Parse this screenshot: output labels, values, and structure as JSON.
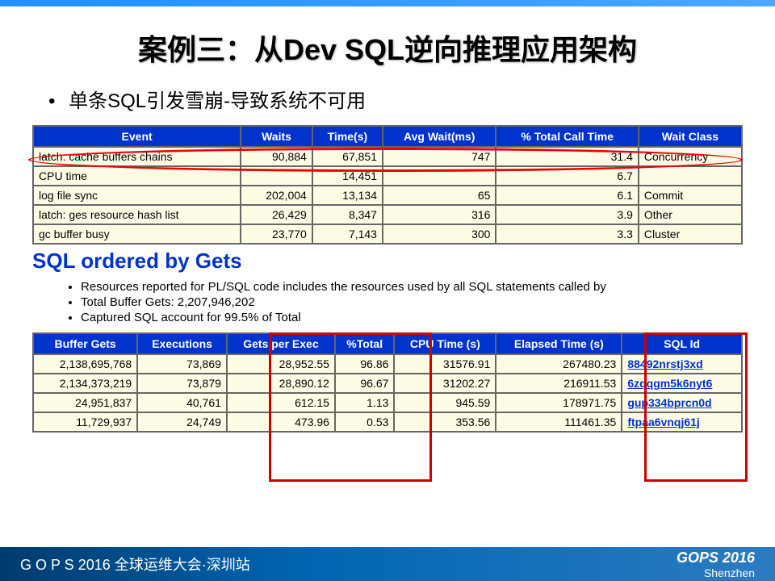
{
  "title": "案例三：从Dev SQL逆向推理应用架构",
  "bullet": "单条SQL引发雪崩-导致系统不可用",
  "table1": {
    "headers": [
      "Event",
      "Waits",
      "Time(s)",
      "Avg Wait(ms)",
      "% Total Call Time",
      "Wait Class"
    ],
    "rows": [
      [
        "latch: cache buffers chains",
        "90,884",
        "67,851",
        "747",
        "31.4",
        "Concurrency"
      ],
      [
        "CPU time",
        "",
        "14,451",
        "",
        "6.7",
        ""
      ],
      [
        "log file sync",
        "202,004",
        "13,134",
        "65",
        "6.1",
        "Commit"
      ],
      [
        "latch: ges resource hash list",
        "26,429",
        "8,347",
        "316",
        "3.9",
        "Other"
      ],
      [
        "gc buffer busy",
        "23,770",
        "7,143",
        "300",
        "3.3",
        "Cluster"
      ]
    ]
  },
  "section_title": "SQL ordered by Gets",
  "notes": [
    "Resources reported for PL/SQL code includes the resources used by all SQL statements called by",
    "Total Buffer Gets: 2,207,946,202",
    "Captured SQL account for 99.5% of Total"
  ],
  "table2": {
    "headers": [
      "Buffer Gets",
      "Executions",
      "Gets per Exec",
      "%Total",
      "CPU Time (s)",
      "Elapsed Time (s)",
      "SQL Id"
    ],
    "rows": [
      [
        "2,138,695,768",
        "73,869",
        "28,952.55",
        "96.86",
        "31576.91",
        "267480.23",
        "88492nrstj3xd"
      ],
      [
        "2,134,373,219",
        "73,879",
        "28,890.12",
        "96.67",
        "31202.27",
        "216911.53",
        "6zqqgm5k6nyt6"
      ],
      [
        "24,951,837",
        "40,761",
        "612.15",
        "1.13",
        "945.59",
        "178971.75",
        "gup334bprcn0d"
      ],
      [
        "11,729,937",
        "24,749",
        "473.96",
        "0.53",
        "353.56",
        "111461.35",
        "ftpaa6vnqj61j"
      ]
    ]
  },
  "footer": {
    "left": "G O P S 2016 全球运维大会·深圳站",
    "brand": "GOPS 2016",
    "city": "Shenzhen"
  }
}
